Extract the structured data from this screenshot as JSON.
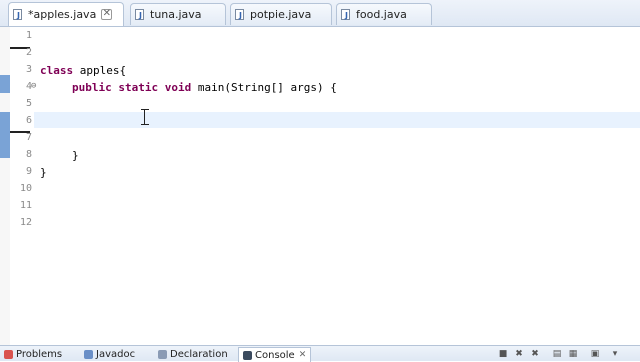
{
  "editor_tabs": [
    {
      "label": "*apples.java",
      "active": true,
      "close": "✕"
    },
    {
      "label": "tuna.java",
      "active": false
    },
    {
      "label": "potpie.java",
      "active": false
    },
    {
      "label": "food.java",
      "active": false
    }
  ],
  "editor": {
    "line_numbers": [
      "1",
      "2",
      "3",
      "4",
      "5",
      "6",
      "7",
      "8",
      "9",
      "10",
      "11",
      "12"
    ],
    "code": {
      "line3_kw": "class",
      "line3_rest": " apples{",
      "line4_kw": "public static void",
      "line4_rest": " main(String[] args) {",
      "line8": "}",
      "line9": "}"
    },
    "fold_marker": "⊖"
  },
  "bottom_views": {
    "problems": "Problems",
    "javadoc": "Javadoc",
    "declaration": "Declaration",
    "console": "Console",
    "console_close": "✕"
  },
  "colors": {
    "keyword": "#7f0055",
    "current_line": "#e8f2fe",
    "gutter_mark": "#7aa3d6"
  }
}
